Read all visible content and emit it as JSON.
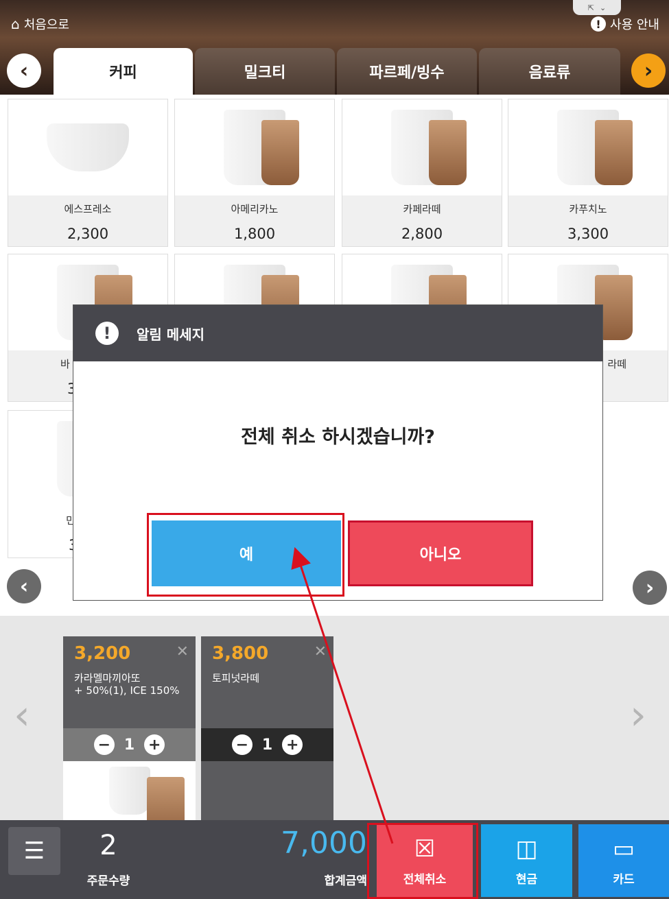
{
  "header": {
    "home_label": "처음으로",
    "guide_label": "사용 안내",
    "tabs": [
      {
        "label": "커피"
      },
      {
        "label": "밀크티"
      },
      {
        "label": "파르페/빙수"
      },
      {
        "label": "음료류"
      }
    ],
    "prev_icon": "chevron-left-icon",
    "next_icon": "chevron-right-icon"
  },
  "products": [
    {
      "name": "에스프레소",
      "price": "2,300"
    },
    {
      "name": "아메리카노",
      "price": "1,800"
    },
    {
      "name": "카페라떼",
      "price": "2,800"
    },
    {
      "name": "카푸치노",
      "price": "3,300"
    }
  ],
  "partial_products": {
    "row2_left_name": "바",
    "row2_left_price": "3",
    "row2_right_name": "라떼",
    "row2_right_price": "0",
    "row3_left_name": "민",
    "row3_left_price": "3"
  },
  "dialog": {
    "title": "알림 메세지",
    "message": "전체 취소 하시겠습니까?",
    "yes_label": "예",
    "no_label": "아니오"
  },
  "order_items": [
    {
      "price": "3,200",
      "name_line1": "카라멜마끼아또",
      "name_line2": "+ 50%(1), ICE 150%",
      "qty": "1"
    },
    {
      "price": "3,800",
      "name_line1": "토피넛라떼",
      "name_line2": "",
      "qty": "1"
    }
  ],
  "summary": {
    "count": "2",
    "count_label": "주문수량",
    "total": "7,000",
    "total_label": "합계금액"
  },
  "actions": {
    "cancel_all_label": "전체취소",
    "cash_label": "현금",
    "card_label": "카드"
  },
  "colors": {
    "yes_button": "#39a9e8",
    "no_button": "#ee4a5a",
    "cancel_all": "#ee4a5a",
    "cash": "#1ba3e8",
    "card": "#1e90e8",
    "price_accent": "#f4a82a",
    "total_accent": "#49b9ee",
    "annotation_red": "#d9101e"
  }
}
